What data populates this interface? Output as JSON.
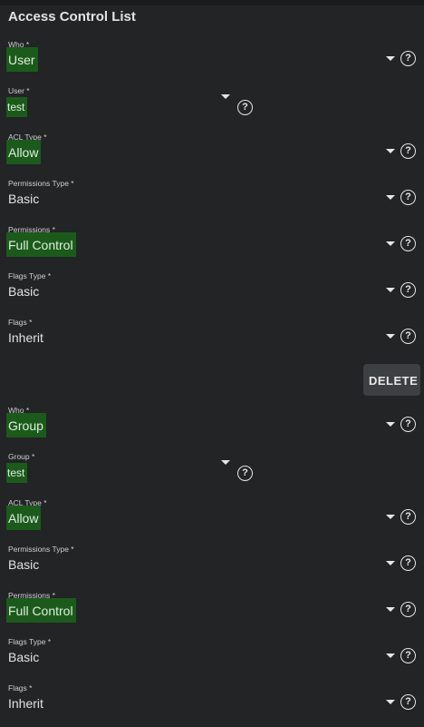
{
  "title": "Access Control List",
  "entries": [
    {
      "fields": [
        {
          "label": "Who *",
          "value": "User"
        },
        {
          "label": "User *",
          "value": "test"
        },
        {
          "label": "ACL Type *",
          "value": "Allow"
        },
        {
          "label": "Permissions Type *",
          "value": "Basic"
        },
        {
          "label": "Permissions *",
          "value": "Full Control"
        },
        {
          "label": "Flags Type *",
          "value": "Basic"
        },
        {
          "label": "Flags *",
          "value": "Inherit"
        }
      ],
      "delete_label": "DELETE"
    },
    {
      "fields": [
        {
          "label": "Who *",
          "value": "Group"
        },
        {
          "label": "Group *",
          "value": "test"
        },
        {
          "label": "ACL Type *",
          "value": "Allow"
        },
        {
          "label": "Permissions Type *",
          "value": "Basic"
        },
        {
          "label": "Permissions *",
          "value": "Full Control"
        },
        {
          "label": "Flags Type *",
          "value": "Basic"
        },
        {
          "label": "Flags *",
          "value": "Inherit"
        }
      ]
    }
  ],
  "icons": {
    "dropdown": "caret-down-icon",
    "help": "help-circle-icon"
  },
  "colors": {
    "background": "#222426",
    "highlight": "#1c5a1c",
    "button": "#3d4043"
  }
}
